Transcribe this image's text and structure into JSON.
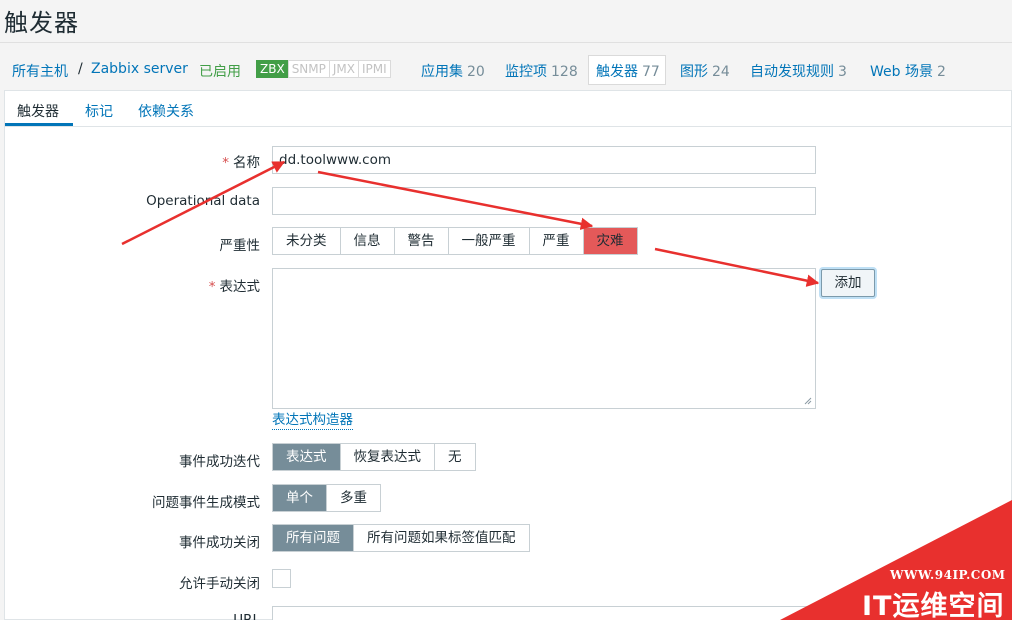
{
  "page_title": "触发器",
  "host_nav": {
    "all_hosts": "所有主机",
    "separator": "/",
    "host": "Zabbix server",
    "status": "已启用",
    "availability": [
      "ZBX",
      "SNMP",
      "JMX",
      "IPMI"
    ],
    "items": [
      {
        "label": "应用集",
        "count": "20"
      },
      {
        "label": "监控项",
        "count": "128"
      },
      {
        "label": "触发器",
        "count": "77"
      },
      {
        "label": "图形",
        "count": "24"
      },
      {
        "label": "自动发现规则",
        "count": "3"
      },
      {
        "label": "Web 场景",
        "count": "2"
      }
    ]
  },
  "tabs": [
    "触发器",
    "标记",
    "依赖关系"
  ],
  "form": {
    "name_label": "名称",
    "name_value": "dd.toolwww.com",
    "opdata_label": "Operational data",
    "opdata_value": "",
    "severity_label": "严重性",
    "severity_options": [
      "未分类",
      "信息",
      "警告",
      "一般严重",
      "严重",
      "灾难"
    ],
    "severity_selected": "灾难",
    "expression_label": "表达式",
    "expression_value": "",
    "add_button": "添加",
    "builder_link": "表达式构造器",
    "ok_event_label": "事件成功迭代",
    "ok_event_options": [
      "表达式",
      "恢复表达式",
      "无"
    ],
    "problem_mode_label": "问题事件生成模式",
    "problem_mode_options": [
      "单个",
      "多重"
    ],
    "ok_close_label": "事件成功关闭",
    "ok_close_options": [
      "所有问题",
      "所有问题如果标签值匹配"
    ],
    "manual_close_label": "允许手动关闭",
    "url_label": "URL"
  },
  "watermark": {
    "url": "WWW.94IP.COM",
    "brand": "IT运维空间"
  },
  "colors": {
    "link": "#0275b8",
    "enabled": "#429e47",
    "selected": "#768d99",
    "disaster": "#e45959",
    "arrow": "#e8302e"
  }
}
